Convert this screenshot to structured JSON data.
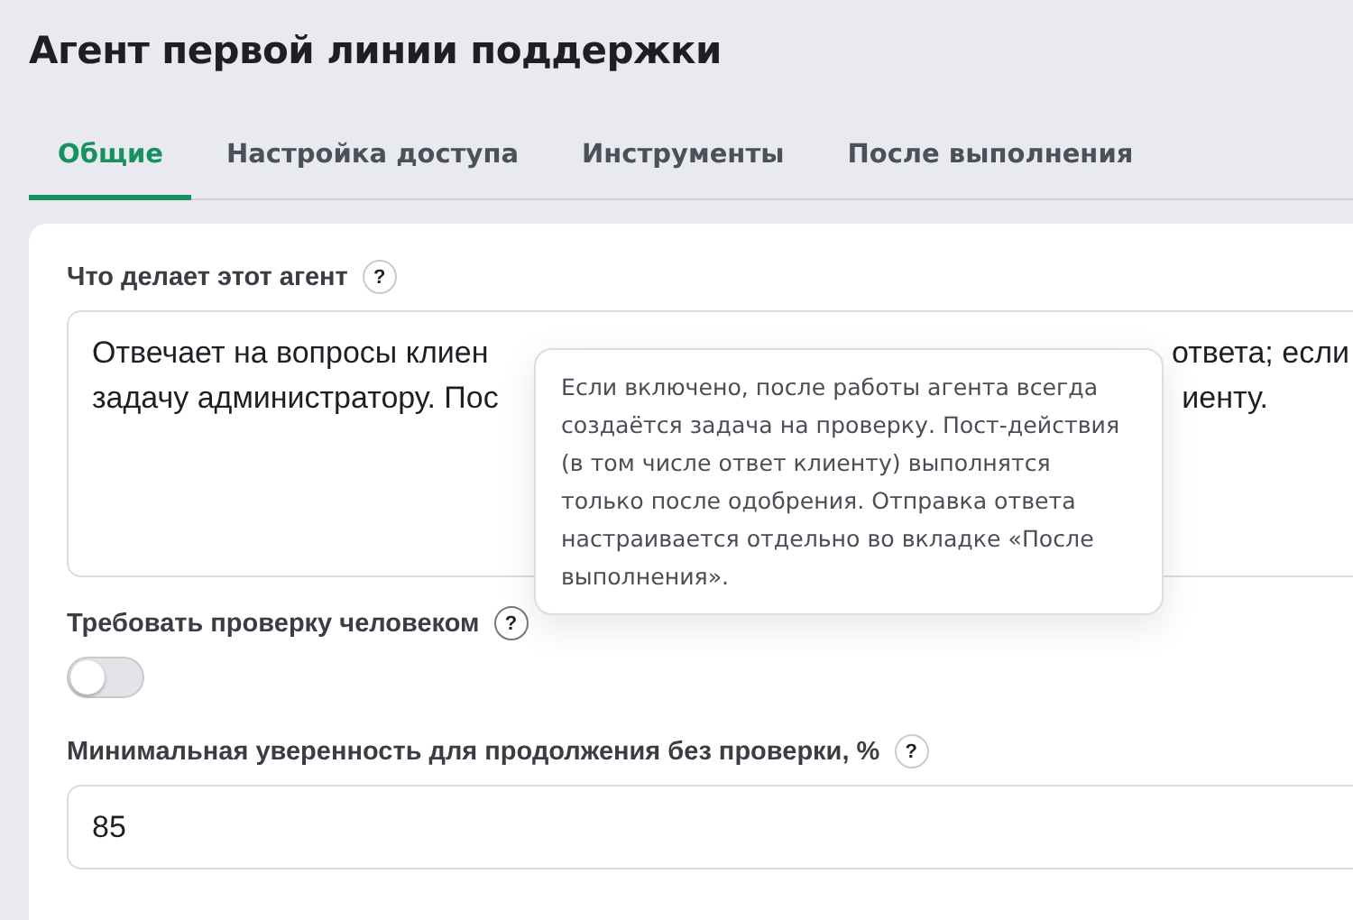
{
  "title": "Агент первой линии поддержки",
  "tabs": [
    {
      "label": "Общие",
      "selected": true
    },
    {
      "label": "Настройка доступа",
      "selected": false
    },
    {
      "label": "Инструменты",
      "selected": false
    },
    {
      "label": "После выполнения",
      "selected": false
    }
  ],
  "fields": [
    {
      "kind": "textarea",
      "label": "Что делает этот агент",
      "help": "?",
      "lines": [
        {
          "left": "Отвечает на вопросы клиен",
          "right": "ответа; если"
        },
        {
          "left": "задачу администратору. Пос",
          "right": "иенту."
        }
      ]
    },
    {
      "kind": "toggle",
      "label": "Требовать проверку человеком",
      "help": "?",
      "on": false,
      "tooltip": "Если включено, после работы агента всегда создаётся задача на проверку. Пост-действия (в том числе ответ клиенту) выполнятся только после одобрения. Отправка ответа настраивается отдельно во вкладке «После выполнения»."
    },
    {
      "kind": "input",
      "label": "Минимальная уверенность для продолжения без проверки, %",
      "help": "?",
      "value": "85"
    }
  ]
}
